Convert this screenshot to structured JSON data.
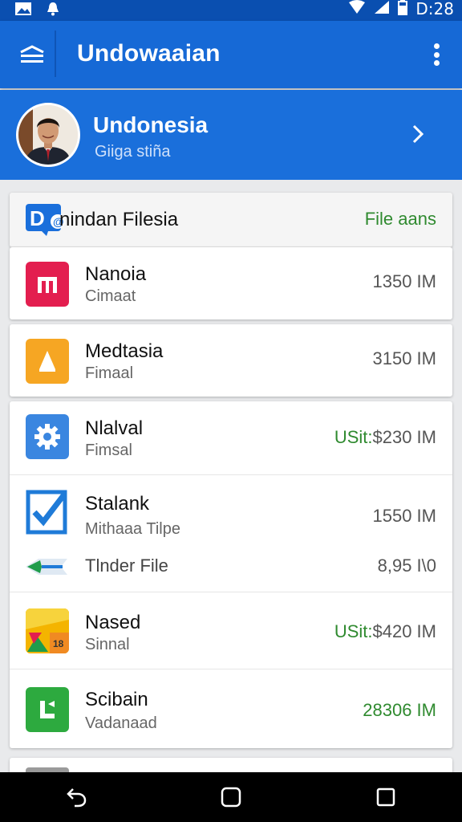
{
  "status_bar": {
    "time": "D:28"
  },
  "app_bar": {
    "title": "Undowaaian"
  },
  "profile": {
    "name": "Undonesia",
    "subtitle": "Giiga stiña"
  },
  "file_list": {
    "header": {
      "logo_text": "D",
      "title": "nindan Filesia",
      "action_label": "File aans"
    },
    "items": [
      {
        "title": "Nanoia",
        "subtitle": "Cimaat",
        "value": "1350 IM",
        "value_prefix": "",
        "value_color": "gray",
        "icon": "app-icon-red",
        "color": "#e31e4f"
      },
      {
        "title": "Medtasia",
        "subtitle": "Fimaal",
        "value": "3150 IM",
        "value_prefix": "",
        "value_color": "gray",
        "icon": "app-icon-yellow",
        "color": "#f6a623"
      },
      {
        "title": "Nlalval",
        "subtitle": "Fimsal",
        "value": "$230 IM",
        "value_prefix": "USit:",
        "value_color": "gray",
        "icon": "gear-icon",
        "color": "#3a86e0"
      },
      {
        "title": "Stalank",
        "subtitle": "Mithaaa Tilpe",
        "value": "1550 IM",
        "value_prefix": "",
        "value_color": "gray",
        "icon": "checkbox-icon",
        "color": "#1f7bd8"
      },
      {
        "title": "Tlnder File",
        "subtitle": "",
        "value": "8,95 I\\0",
        "value_prefix": "",
        "value_color": "gray",
        "icon": "flag-icon",
        "color": "#1f9c4b"
      },
      {
        "title": "Nased",
        "subtitle": "Sinnal",
        "value": "$420 IM",
        "value_prefix": "USit:",
        "value_color": "gray",
        "icon": "app-icon-multicolor",
        "color": "#f4b400"
      },
      {
        "title": "Scibain",
        "subtitle": "Vadanaad",
        "value": "28306 IM",
        "value_prefix": "",
        "value_color": "green",
        "icon": "app-icon-green",
        "color": "#2daa3f"
      }
    ]
  },
  "colors": {
    "primary": "#1669d6",
    "status_bar": "#0a4fb0",
    "accent_green": "#2f8a2f"
  },
  "nav": {
    "back": "back-icon",
    "home": "home-icon",
    "recents": "recents-icon"
  }
}
